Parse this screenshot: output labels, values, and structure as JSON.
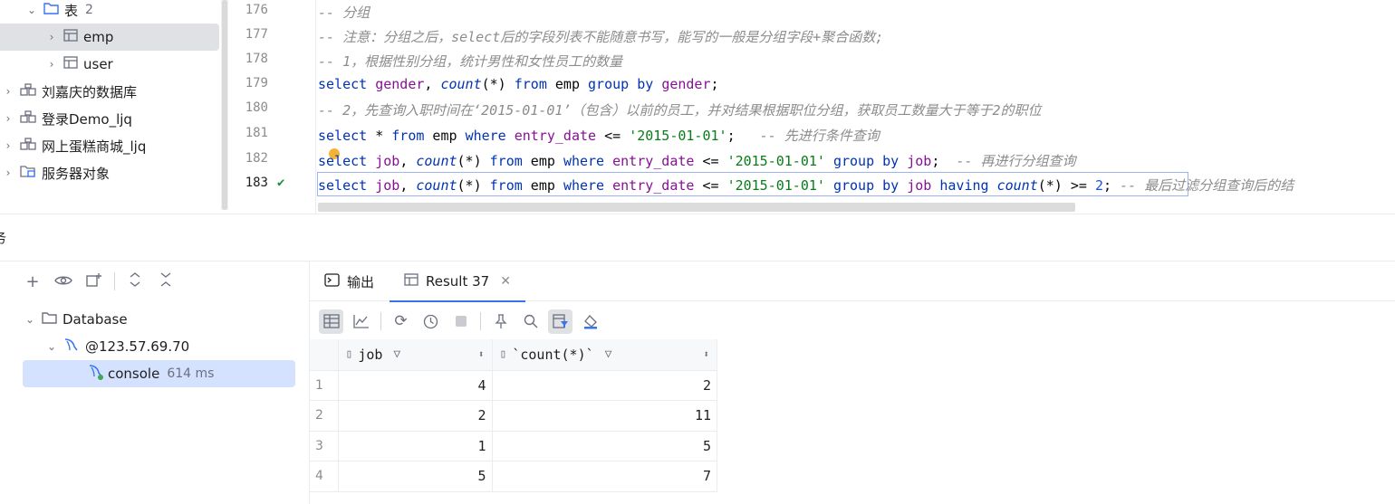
{
  "tree": {
    "tables_folder": {
      "label": "表",
      "count": "2"
    },
    "table_emp": "emp",
    "table_user": "user",
    "schema_1": "刘嘉庆的数据库",
    "schema_2": "登录Demo_ljq",
    "schema_3": "网上蛋糕商城_ljq",
    "server_objects": "服务器对象"
  },
  "editor": {
    "line_numbers": [
      "176",
      "177",
      "178",
      "179",
      "180",
      "181",
      "182",
      "183"
    ],
    "line_176": "-- 分组",
    "line_177": "-- 注意：分组之后，select后的字段列表不能随意书写，能写的一般是分组字段+聚合函数;",
    "line_178": "-- 1，根据性别分组，统计男性和女性员工的数量",
    "line_179": {
      "k1": "select",
      "c1": "gender",
      "p1": ", ",
      "f1": "count",
      "p2": "(*) ",
      "k2": "from",
      "p3": " emp ",
      "k3": "group by",
      "p4": " ",
      "c2": "gender",
      "p5": ";"
    },
    "line_180": "-- 2，先查询入职时间在‘2015-01-01’（包含）以前的员工，并对结果根据职位分组，获取员工数量大于等于2的职位",
    "line_181": {
      "k1": "select",
      "p1": " * ",
      "k2": "from",
      "p2": " emp ",
      "k3": "where",
      "p3": " ",
      "c1": "entry_date",
      "p4": " <= ",
      "s1": "'2015-01-01'",
      "p5": ";   ",
      "cm": "-- 先进行条件查询"
    },
    "line_182": {
      "k1": "select",
      "p0": " ",
      "c1": "job",
      "p1": ", ",
      "f1": "count",
      "p2": "(*) ",
      "k2": "from",
      "p3": " emp ",
      "k3": "where",
      "p4": " ",
      "c2": "entry_date",
      "p5": " <= ",
      "s1": "'2015-01-01'",
      "p6": " ",
      "k4": "group by",
      "p7": " ",
      "c3": "job",
      "p8": ";  ",
      "cm": "-- 再进行分组查询"
    },
    "line_183": {
      "k1": "select",
      "p0": " ",
      "c1": "job",
      "p1": ", ",
      "f1": "count",
      "p2": "(*) ",
      "k2": "from",
      "p3": " emp ",
      "k3": "where",
      "p4": " ",
      "c2": "entry_date",
      "p5": " <= ",
      "s1": "'2015-01-01'",
      "p6": " ",
      "k4": "group by",
      "p7": " ",
      "c3": "job",
      "p8": " ",
      "k5": "having",
      "p9": " ",
      "f2": "count",
      "p10": "(*) >= ",
      "n1": "2",
      "p11": "; ",
      "cm": "-- 最后过滤分组查询后的结"
    }
  },
  "services": {
    "title": "务",
    "database": "Database",
    "host": "@123.57.69.70",
    "console": "console",
    "console_time": "614 ms"
  },
  "results": {
    "tab_output": "输出",
    "tab_result": "Result 37",
    "columns": [
      "job",
      "`count(*)`"
    ],
    "rows": [
      {
        "n": "1",
        "job": "4",
        "count": "2"
      },
      {
        "n": "2",
        "job": "2",
        "count": "11"
      },
      {
        "n": "3",
        "job": "1",
        "count": "5"
      },
      {
        "n": "4",
        "job": "5",
        "count": "7"
      }
    ]
  },
  "icons": {
    "folder": "folder-icon",
    "table": "table-icon",
    "schema": "schema-icon",
    "server_objects": "server-objects-icon",
    "success": "check-icon"
  },
  "colors": {
    "keyword": "#0033b3",
    "string": "#067d17",
    "column": "#871094",
    "comment": "#8c8c8c",
    "accent": "#3574f0"
  }
}
